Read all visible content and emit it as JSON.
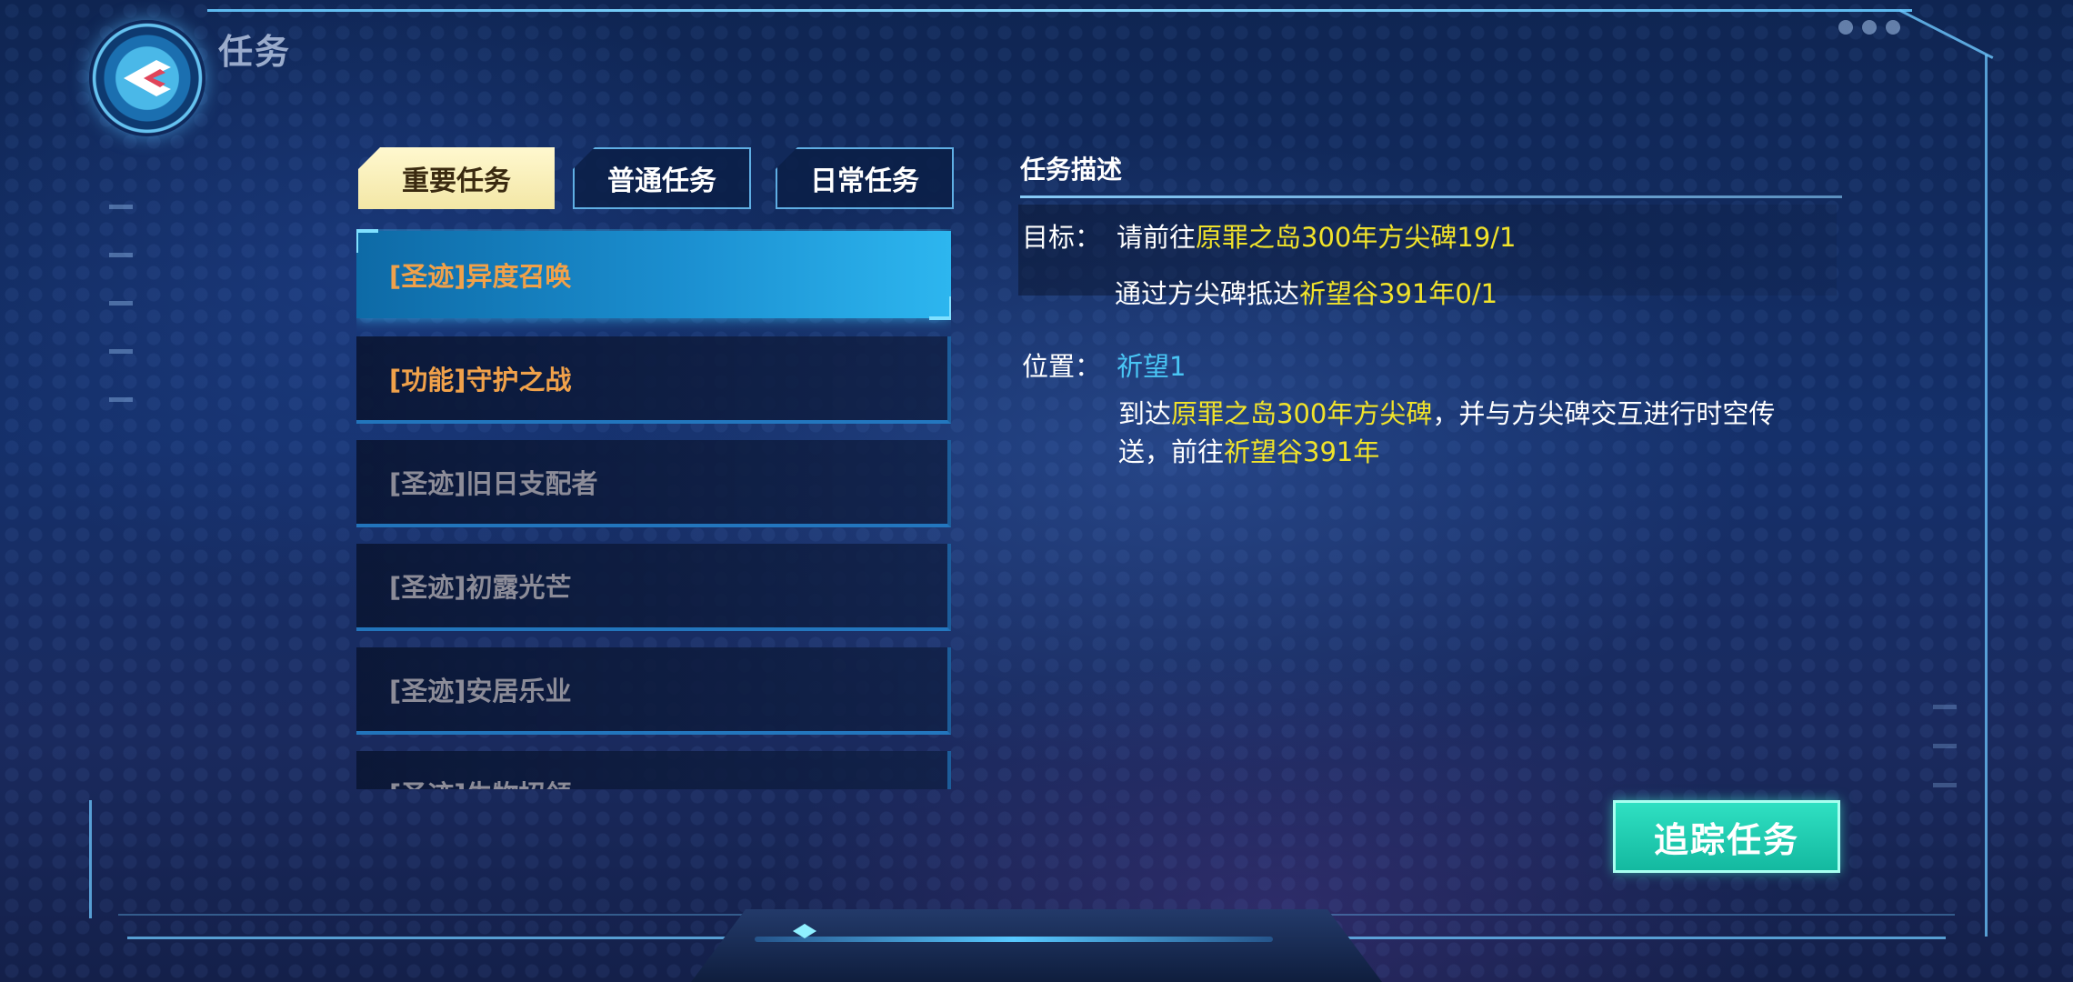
{
  "header": {
    "title": "任务"
  },
  "tabs": [
    {
      "label": "重要任务",
      "active": true
    },
    {
      "label": "普通任务",
      "active": false
    },
    {
      "label": "日常任务",
      "active": false
    }
  ],
  "quests": [
    {
      "label": "[圣迹]异度召唤",
      "state": "selected"
    },
    {
      "label": "[功能]守护之战",
      "state": "available"
    },
    {
      "label": "[圣迹]旧日支配者",
      "state": "locked"
    },
    {
      "label": "[圣迹]初露光芒",
      "state": "locked"
    },
    {
      "label": "[圣迹]安居乐业",
      "state": "locked"
    },
    {
      "label": "[圣迹]生物招领",
      "state": "locked"
    }
  ],
  "description": {
    "heading": "任务描述",
    "goal_label": "目标：",
    "goal1_prefix": "请前往",
    "goal1_highlight": "原罪之岛300年方尖碑19/1",
    "goal2_prefix": "通过方尖碑抵达",
    "goal2_highlight": "祈望谷391年0/1",
    "location_label": "位置：",
    "location_value": "祈望1",
    "detail_p1": "到达",
    "detail_h1": "原罪之岛300年方尖碑",
    "detail_p2": "，并与方尖碑交互进行时空传",
    "detail_p3": "送，前往",
    "detail_h2": "祈望谷391年"
  },
  "actions": {
    "track_button": "追踪任务"
  },
  "colors": {
    "highlight_yellow": "#f1e32a",
    "location_cyan": "#49c6f5",
    "quest_orange": "#f0a14a",
    "track_button": "#1fc9ad"
  }
}
